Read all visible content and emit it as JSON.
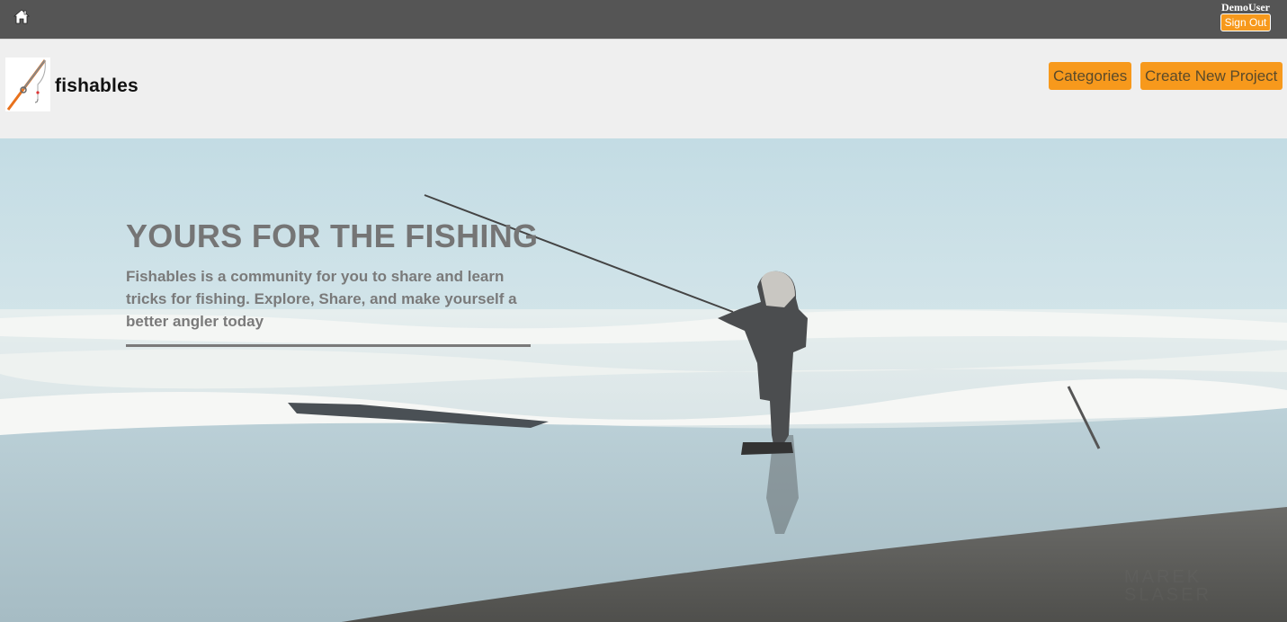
{
  "topbar": {
    "home_icon": "home-icon",
    "username": "DemoUser",
    "signout_label": "Sign Out"
  },
  "header": {
    "logo_icon": "fishing-rod-icon",
    "brand": "fishables",
    "nav": {
      "categories_label": "Categories",
      "create_label": "Create New Project"
    }
  },
  "hero": {
    "title": "YOURS FOR THE FISHING",
    "text": "Fishables is a community for you to share and learn tricks for fishing. Explore, Share, and make yourself a better angler today",
    "watermark": "MAREK SLASER"
  },
  "colors": {
    "topbar": "#555555",
    "header": "#efefef",
    "accent": "#f7991c"
  }
}
